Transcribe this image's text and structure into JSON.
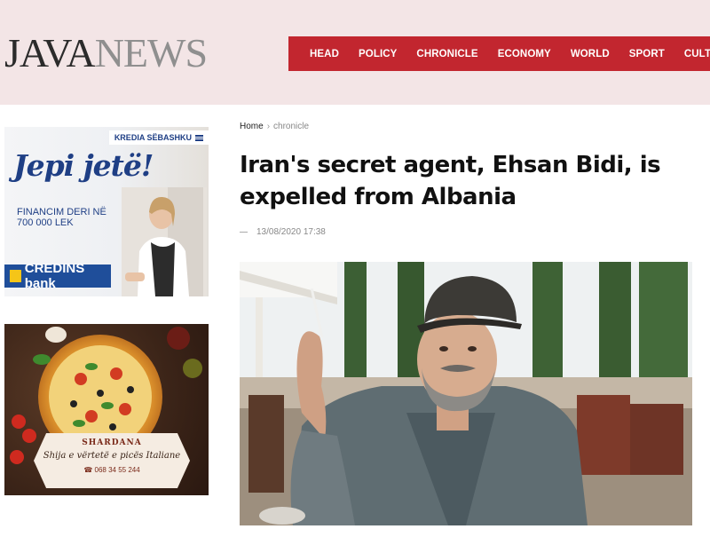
{
  "header": {
    "logo_part1": "JAVA",
    "logo_part2": "NEWS",
    "nav": [
      "HEAD",
      "POLICY",
      "CHRONICLE",
      "ECONOMY",
      "WORLD",
      "SPORT",
      "CULTURE"
    ]
  },
  "ads": {
    "bank": {
      "badge": "KREDIA SËBASHKU",
      "slogan": "Jepi jetë!",
      "subtitle": "FINANCIM DERI NË 700 000 LEK",
      "brand": "CREDINS bank"
    },
    "pizza": {
      "name": "SHARDANA",
      "tagline": "Shija e vërtetë e picës Italiane",
      "phone": "068 34 55 244"
    }
  },
  "article": {
    "breadcrumb_home": "Home",
    "breadcrumb_current": "chronicle",
    "title": "Iran's secret agent, Ehsan Bidi, is expelled from Albania",
    "date": "13/08/2020 17:38"
  },
  "colors": {
    "header_bg": "#f3e5e6",
    "nav_bg": "#c2262f",
    "bank_blue": "#1f3f85"
  }
}
